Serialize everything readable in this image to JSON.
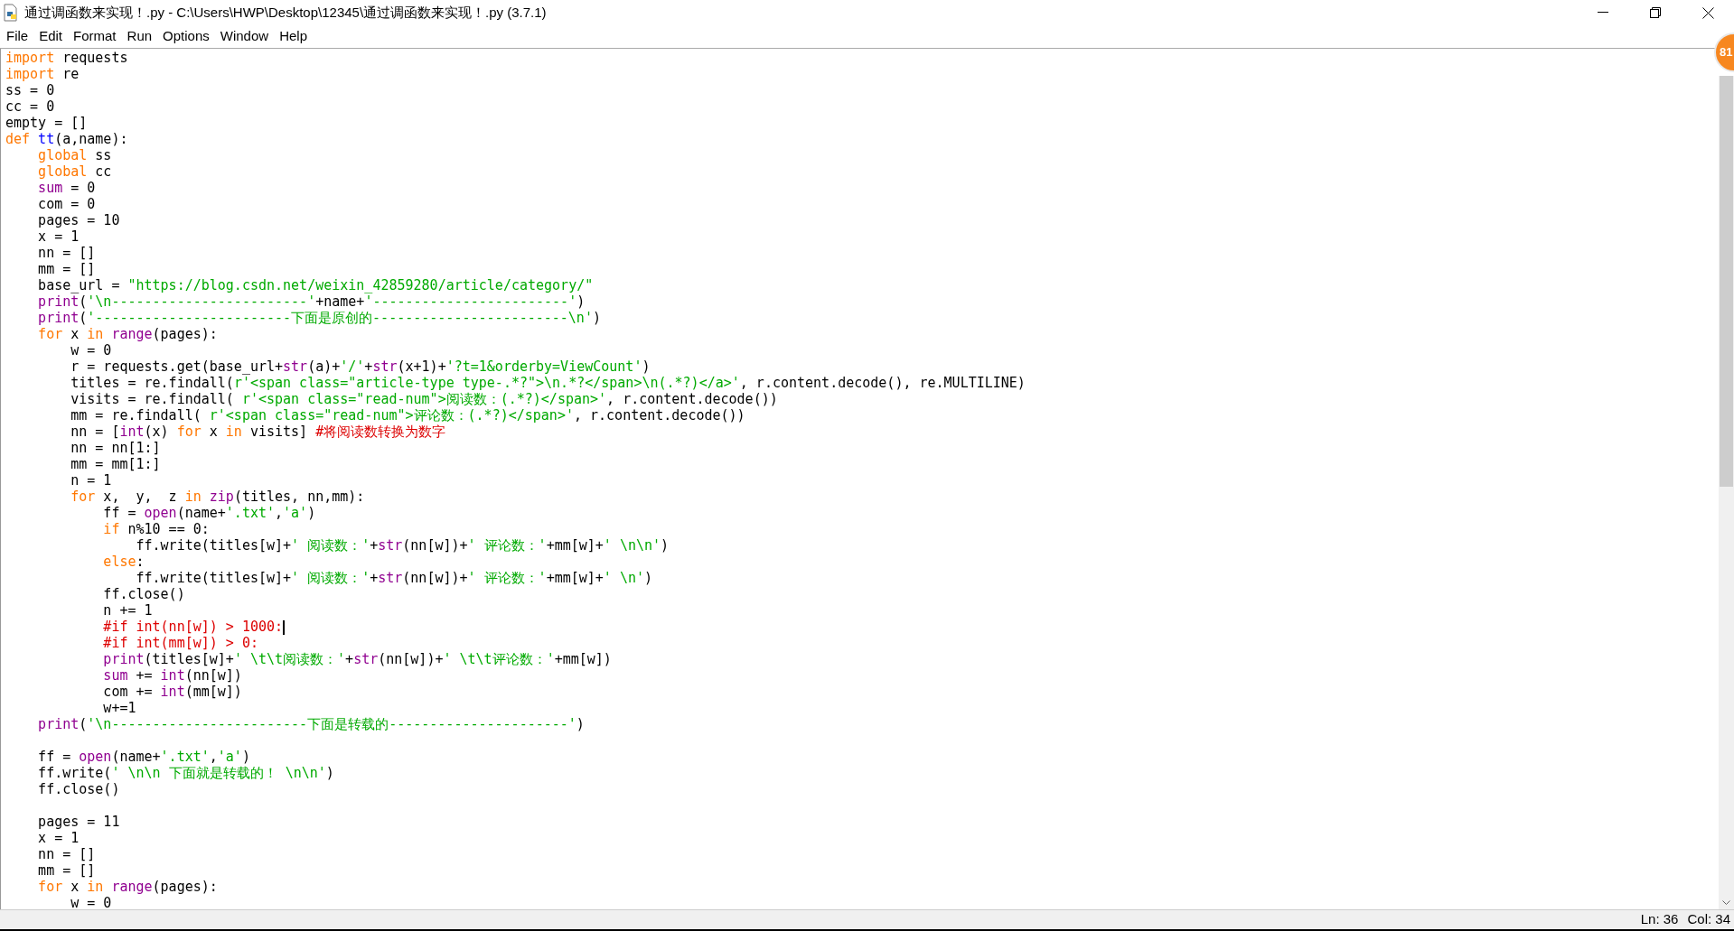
{
  "window": {
    "title": "通过调函数来实现！.py - C:\\Users\\HWP\\Desktop\\12345\\通过调函数来实现！.py (3.7.1)"
  },
  "menu": [
    "File",
    "Edit",
    "Format",
    "Run",
    "Options",
    "Window",
    "Help"
  ],
  "badge": "81",
  "editor": {
    "lines": [
      {
        "kind": "code",
        "tokens": [
          {
            "kind": "kw",
            "t": "import"
          },
          {
            "kind": "p",
            "t": " requests"
          }
        ]
      },
      {
        "kind": "code",
        "tokens": [
          {
            "kind": "kw",
            "t": "import"
          },
          {
            "kind": "p",
            "t": " re"
          }
        ]
      },
      {
        "kind": "code",
        "tokens": [
          {
            "kind": "p",
            "t": "ss = 0"
          }
        ]
      },
      {
        "kind": "code",
        "tokens": [
          {
            "kind": "p",
            "t": "cc = 0"
          }
        ]
      },
      {
        "kind": "code",
        "tokens": [
          {
            "kind": "p",
            "t": "empty = []"
          }
        ]
      },
      {
        "kind": "code",
        "tokens": [
          {
            "kind": "kw",
            "t": "def"
          },
          {
            "kind": "def",
            "t": " tt"
          },
          {
            "kind": "p",
            "t": "(a,name):"
          }
        ]
      },
      {
        "kind": "code",
        "tokens": [
          {
            "kind": "kw",
            "t": "    global"
          },
          {
            "kind": "p",
            "t": " ss"
          }
        ]
      },
      {
        "kind": "code",
        "tokens": [
          {
            "kind": "kw",
            "t": "    global"
          },
          {
            "kind": "p",
            "t": " cc"
          }
        ]
      },
      {
        "kind": "code",
        "tokens": [
          {
            "kind": "bi",
            "t": "    sum"
          },
          {
            "kind": "p",
            "t": " = 0"
          }
        ]
      },
      {
        "kind": "code",
        "tokens": [
          {
            "kind": "p",
            "t": "    com = 0"
          }
        ]
      },
      {
        "kind": "code",
        "tokens": [
          {
            "kind": "p",
            "t": "    pages = 10"
          }
        ]
      },
      {
        "kind": "code",
        "tokens": [
          {
            "kind": "p",
            "t": "    x = 1"
          }
        ]
      },
      {
        "kind": "code",
        "tokens": [
          {
            "kind": "p",
            "t": "    nn = []"
          }
        ]
      },
      {
        "kind": "code",
        "tokens": [
          {
            "kind": "p",
            "t": "    mm = []"
          }
        ]
      },
      {
        "kind": "code",
        "tokens": [
          {
            "kind": "p",
            "t": "    base_url = "
          },
          {
            "kind": "str",
            "t": "\"https://blog.csdn.net/weixin_42859280/article/category/\""
          }
        ]
      },
      {
        "kind": "code",
        "tokens": [
          {
            "kind": "bi",
            "t": "    print"
          },
          {
            "kind": "p",
            "t": "("
          },
          {
            "kind": "str",
            "t": "'\\n------------------------'"
          },
          {
            "kind": "p",
            "t": "+name+"
          },
          {
            "kind": "str",
            "t": "'------------------------'"
          },
          {
            "kind": "p",
            "t": ")"
          }
        ]
      },
      {
        "kind": "code",
        "tokens": [
          {
            "kind": "bi",
            "t": "    print"
          },
          {
            "kind": "p",
            "t": "("
          },
          {
            "kind": "str",
            "t": "'------------------------下面是原创的------------------------\\n'"
          },
          {
            "kind": "p",
            "t": ")"
          }
        ]
      },
      {
        "kind": "code",
        "tokens": [
          {
            "kind": "kw",
            "t": "    for"
          },
          {
            "kind": "p",
            "t": " x "
          },
          {
            "kind": "kw",
            "t": "in"
          },
          {
            "kind": "bi",
            "t": " range"
          },
          {
            "kind": "p",
            "t": "(pages):"
          }
        ]
      },
      {
        "kind": "code",
        "tokens": [
          {
            "kind": "p",
            "t": "        w = 0"
          }
        ]
      },
      {
        "kind": "code",
        "tokens": [
          {
            "kind": "p",
            "t": "        r = requests.get(base_url+"
          },
          {
            "kind": "bi",
            "t": "str"
          },
          {
            "kind": "p",
            "t": "(a)+"
          },
          {
            "kind": "str",
            "t": "'/'"
          },
          {
            "kind": "p",
            "t": "+"
          },
          {
            "kind": "bi",
            "t": "str"
          },
          {
            "kind": "p",
            "t": "(x+1)+"
          },
          {
            "kind": "str",
            "t": "'?t=1&orderby=ViewCount'"
          },
          {
            "kind": "p",
            "t": ")"
          }
        ]
      },
      {
        "kind": "code",
        "tokens": [
          {
            "kind": "p",
            "t": "        titles = re.findall("
          },
          {
            "kind": "str",
            "t": "r'<span class=\"article-type type-.*?\">\\n.*?</span>\\n(.*?)</a>'"
          },
          {
            "kind": "p",
            "t": ", r.content.decode(), re.MULTILINE)"
          }
        ]
      },
      {
        "kind": "code",
        "tokens": [
          {
            "kind": "p",
            "t": "        visits = re.findall( "
          },
          {
            "kind": "str",
            "t": "r'<span class=\"read-num\">阅读数：(.*?)</span>'"
          },
          {
            "kind": "p",
            "t": ", r.content.decode())"
          }
        ]
      },
      {
        "kind": "code",
        "tokens": [
          {
            "kind": "p",
            "t": "        mm = re.findall( "
          },
          {
            "kind": "str",
            "t": "r'<span class=\"read-num\">评论数：(.*?)</span>'"
          },
          {
            "kind": "p",
            "t": ", r.content.decode())"
          }
        ]
      },
      {
        "kind": "code",
        "tokens": [
          {
            "kind": "p",
            "t": "        nn = ["
          },
          {
            "kind": "bi",
            "t": "int"
          },
          {
            "kind": "p",
            "t": "(x) "
          },
          {
            "kind": "kw",
            "t": "for"
          },
          {
            "kind": "p",
            "t": " x "
          },
          {
            "kind": "kw",
            "t": "in"
          },
          {
            "kind": "p",
            "t": " visits] "
          },
          {
            "kind": "com",
            "t": "#将阅读数转换为数字"
          }
        ]
      },
      {
        "kind": "code",
        "tokens": [
          {
            "kind": "p",
            "t": "        nn = nn[1:]"
          }
        ]
      },
      {
        "kind": "code",
        "tokens": [
          {
            "kind": "p",
            "t": "        mm = mm[1:]"
          }
        ]
      },
      {
        "kind": "code",
        "tokens": [
          {
            "kind": "p",
            "t": "        n = 1"
          }
        ]
      },
      {
        "kind": "code",
        "tokens": [
          {
            "kind": "kw",
            "t": "        for"
          },
          {
            "kind": "p",
            "t": " x,  y,  z "
          },
          {
            "kind": "kw",
            "t": "in"
          },
          {
            "kind": "bi",
            "t": " zip"
          },
          {
            "kind": "p",
            "t": "(titles, nn,mm):"
          }
        ]
      },
      {
        "kind": "code",
        "tokens": [
          {
            "kind": "p",
            "t": "            ff = "
          },
          {
            "kind": "bi",
            "t": "open"
          },
          {
            "kind": "p",
            "t": "(name+"
          },
          {
            "kind": "str",
            "t": "'.txt'"
          },
          {
            "kind": "p",
            "t": ","
          },
          {
            "kind": "str",
            "t": "'a'"
          },
          {
            "kind": "p",
            "t": ")"
          }
        ]
      },
      {
        "kind": "code",
        "tokens": [
          {
            "kind": "kw",
            "t": "            if"
          },
          {
            "kind": "p",
            "t": " n%10 == 0:"
          }
        ]
      },
      {
        "kind": "code",
        "tokens": [
          {
            "kind": "p",
            "t": "                ff.write(titles[w]+"
          },
          {
            "kind": "str",
            "t": "' 阅读数：'"
          },
          {
            "kind": "p",
            "t": "+"
          },
          {
            "kind": "bi",
            "t": "str"
          },
          {
            "kind": "p",
            "t": "(nn[w])+"
          },
          {
            "kind": "str",
            "t": "' 评论数：'"
          },
          {
            "kind": "p",
            "t": "+mm[w]+"
          },
          {
            "kind": "str",
            "t": "' \\n\\n'"
          },
          {
            "kind": "p",
            "t": ")"
          }
        ]
      },
      {
        "kind": "code",
        "tokens": [
          {
            "kind": "kw",
            "t": "            else"
          },
          {
            "kind": "p",
            "t": ":"
          }
        ]
      },
      {
        "kind": "code",
        "tokens": [
          {
            "kind": "p",
            "t": "                ff.write(titles[w]+"
          },
          {
            "kind": "str",
            "t": "' 阅读数：'"
          },
          {
            "kind": "p",
            "t": "+"
          },
          {
            "kind": "bi",
            "t": "str"
          },
          {
            "kind": "p",
            "t": "(nn[w])+"
          },
          {
            "kind": "str",
            "t": "' 评论数：'"
          },
          {
            "kind": "p",
            "t": "+mm[w]+"
          },
          {
            "kind": "str",
            "t": "' \\n'"
          },
          {
            "kind": "p",
            "t": ")"
          }
        ]
      },
      {
        "kind": "code",
        "tokens": [
          {
            "kind": "p",
            "t": "            ff.close()"
          }
        ]
      },
      {
        "kind": "code",
        "tokens": [
          {
            "kind": "p",
            "t": "            n += 1"
          }
        ]
      },
      {
        "kind": "code",
        "cursor": true,
        "tokens": [
          {
            "kind": "com",
            "t": "            #if int(nn[w]) > 1000:"
          }
        ]
      },
      {
        "kind": "code",
        "tokens": [
          {
            "kind": "com",
            "t": "            #if int(mm[w]) > 0:"
          }
        ]
      },
      {
        "kind": "code",
        "tokens": [
          {
            "kind": "bi",
            "t": "            print"
          },
          {
            "kind": "p",
            "t": "(titles[w]+"
          },
          {
            "kind": "str",
            "t": "' \\t\\t阅读数：'"
          },
          {
            "kind": "p",
            "t": "+"
          },
          {
            "kind": "bi",
            "t": "str"
          },
          {
            "kind": "p",
            "t": "(nn[w])+"
          },
          {
            "kind": "str",
            "t": "' \\t\\t评论数：'"
          },
          {
            "kind": "p",
            "t": "+mm[w])"
          }
        ]
      },
      {
        "kind": "code",
        "tokens": [
          {
            "kind": "bi",
            "t": "            sum"
          },
          {
            "kind": "p",
            "t": " += "
          },
          {
            "kind": "bi",
            "t": "int"
          },
          {
            "kind": "p",
            "t": "(nn[w])"
          }
        ]
      },
      {
        "kind": "code",
        "tokens": [
          {
            "kind": "p",
            "t": "            com += "
          },
          {
            "kind": "bi",
            "t": "int"
          },
          {
            "kind": "p",
            "t": "(mm[w])"
          }
        ]
      },
      {
        "kind": "code",
        "tokens": [
          {
            "kind": "p",
            "t": "            w+=1"
          }
        ]
      },
      {
        "kind": "code",
        "tokens": [
          {
            "kind": "bi",
            "t": "    print"
          },
          {
            "kind": "p",
            "t": "("
          },
          {
            "kind": "str",
            "t": "'\\n------------------------下面是转载的----------------------'"
          },
          {
            "kind": "p",
            "t": ")"
          }
        ]
      },
      {
        "kind": "blank"
      },
      {
        "kind": "code",
        "tokens": [
          {
            "kind": "p",
            "t": "    ff = "
          },
          {
            "kind": "bi",
            "t": "open"
          },
          {
            "kind": "p",
            "t": "(name+"
          },
          {
            "kind": "str",
            "t": "'.txt'"
          },
          {
            "kind": "p",
            "t": ","
          },
          {
            "kind": "str",
            "t": "'a'"
          },
          {
            "kind": "p",
            "t": ")"
          }
        ]
      },
      {
        "kind": "code",
        "tokens": [
          {
            "kind": "p",
            "t": "    ff.write("
          },
          {
            "kind": "str",
            "t": "' \\n\\n 下面就是转载的！ \\n\\n'"
          },
          {
            "kind": "p",
            "t": ")"
          }
        ]
      },
      {
        "kind": "code",
        "tokens": [
          {
            "kind": "p",
            "t": "    ff.close()"
          }
        ]
      },
      {
        "kind": "blank"
      },
      {
        "kind": "code",
        "tokens": [
          {
            "kind": "p",
            "t": "    pages = 11"
          }
        ]
      },
      {
        "kind": "code",
        "tokens": [
          {
            "kind": "p",
            "t": "    x = 1"
          }
        ]
      },
      {
        "kind": "code",
        "tokens": [
          {
            "kind": "p",
            "t": "    nn = []"
          }
        ]
      },
      {
        "kind": "code",
        "tokens": [
          {
            "kind": "p",
            "t": "    mm = []"
          }
        ]
      },
      {
        "kind": "code",
        "tokens": [
          {
            "kind": "kw",
            "t": "    for"
          },
          {
            "kind": "p",
            "t": " x "
          },
          {
            "kind": "kw",
            "t": "in"
          },
          {
            "kind": "bi",
            "t": " range"
          },
          {
            "kind": "p",
            "t": "(pages):"
          }
        ]
      },
      {
        "kind": "code",
        "tokens": [
          {
            "kind": "p",
            "t": "        w = 0"
          }
        ]
      }
    ]
  },
  "status_bar": {
    "line": "Ln: 36",
    "column": "Col: 34"
  }
}
